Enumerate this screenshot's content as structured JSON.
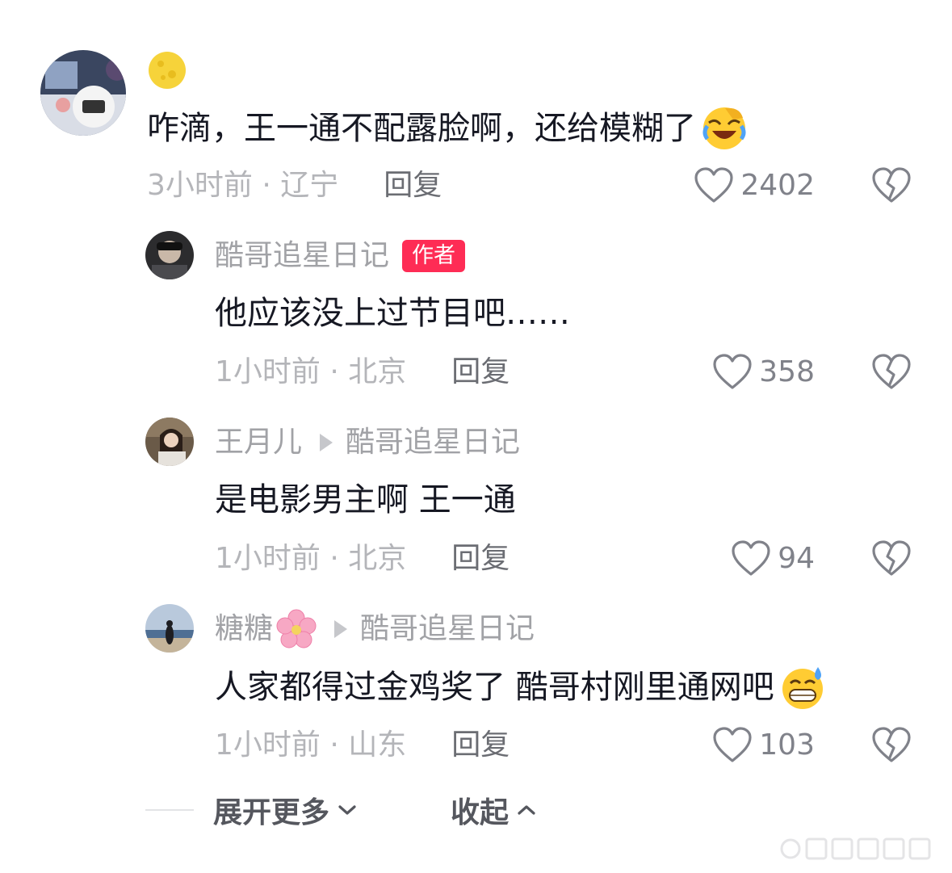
{
  "comments": [
    {
      "username": "",
      "text": "咋滴，王一通不配露脸啊，还给模糊了",
      "emoji": "laughing-crying-emoji",
      "meta": "3小时前 · 辽宁",
      "reply_label": "回复",
      "likes": "2402"
    },
    {
      "username": "酷哥追星日记",
      "badge": "作者",
      "text": "他应该没上过节目吧……",
      "meta": "1小时前 · 北京",
      "reply_label": "回复",
      "likes": "358"
    },
    {
      "username": "王月儿",
      "reply_to": "酷哥追星日记",
      "text": "是电影男主啊 王一通",
      "meta": "1小时前 · 北京",
      "reply_label": "回复",
      "likes": "94"
    },
    {
      "username": "糖糖",
      "username_emoji": "cherry-blossom-emoji",
      "reply_to": "酷哥追星日记",
      "text": "人家都得过金鸡奖了  酷哥村刚里通网吧",
      "emoji": "grinning-sweat-emoji",
      "meta": "1小时前 · 山东",
      "reply_label": "回复",
      "likes": "103"
    }
  ],
  "footer": {
    "expand_label": "展开更多",
    "collapse_label": "收起"
  },
  "colors": {
    "badge": "#fe2c55",
    "username": "#a1a2a6",
    "text": "#161823",
    "meta": "#b4b5b9",
    "icon": "#80828a"
  }
}
